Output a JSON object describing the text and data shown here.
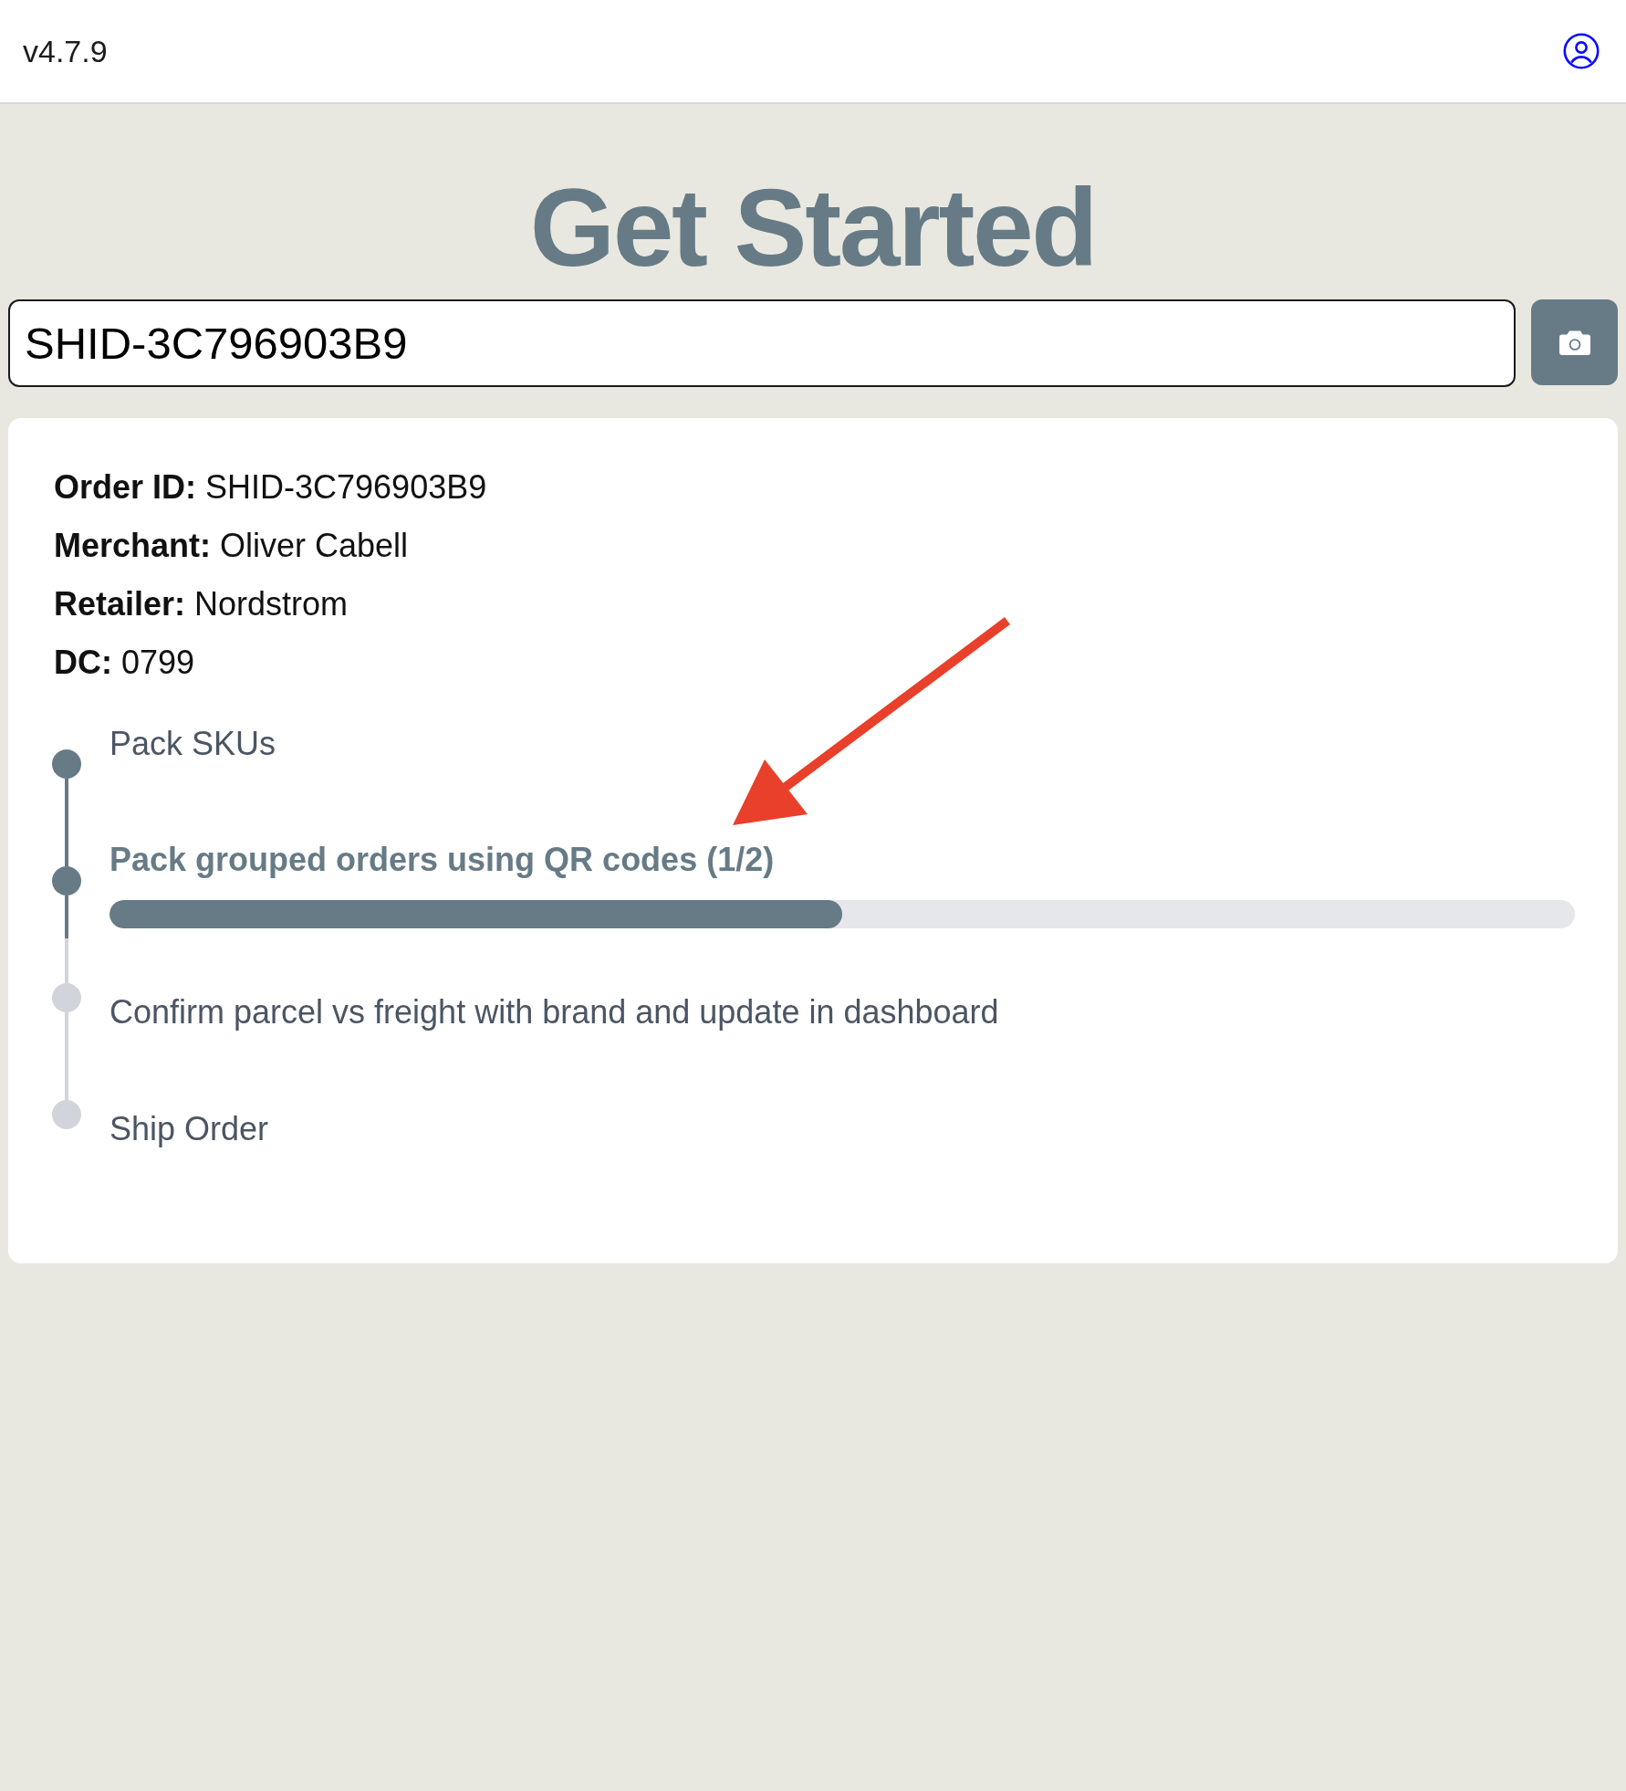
{
  "header": {
    "version": "v4.7.9"
  },
  "title": "Get Started",
  "search": {
    "value": "SHID-3C796903B9"
  },
  "details": [
    "**Order ID:** SHID-3C796903B9",
    "**Merchant:** Oliver Cabell",
    "**Retailer:** Nordstrom",
    "**DC:** 0799"
  ],
  "steps": [
    {
      "label": "Pack SKUs",
      "started": true,
      "active": false
    },
    {
      "label": "Pack grouped orders using QR codes (1/2)",
      "started": true,
      "active": true,
      "level": 0.5
    },
    {
      "label": "Confirm parcel vs freight with brand and update in dashboard",
      "started": false,
      "active": false
    },
    {
      "label": "Ship Order",
      "started": false,
      "active": false
    }
  ]
}
